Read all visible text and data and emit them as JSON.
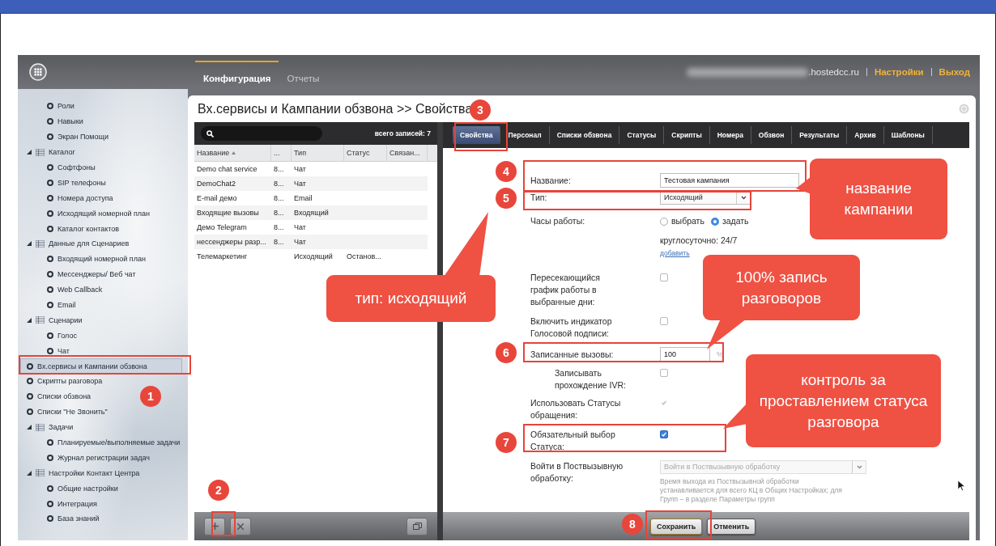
{
  "header": {
    "tabs": [
      {
        "label": "Конфигурация",
        "selected": true
      },
      {
        "label": "Отчеты",
        "selected": false
      }
    ],
    "domain": ".hostedcc.ru",
    "links": [
      "Настройки",
      "Выход"
    ]
  },
  "sidebar": {
    "items": [
      {
        "kind": "group",
        "children": [
          {
            "label": "Роли",
            "selected": false
          },
          {
            "label": "Навыки",
            "selected": false
          },
          {
            "label": "Экран Помощи",
            "selected": false
          }
        ]
      },
      {
        "kind": "group",
        "label": "Каталог",
        "expanded": true,
        "children": [
          {
            "label": "Софтфоны",
            "selected": false
          },
          {
            "label": "SIP телефоны",
            "selected": false
          },
          {
            "label": "Номера доступа",
            "selected": false
          },
          {
            "label": "Исходящий номерной план",
            "selected": false
          },
          {
            "label": "Каталог контактов",
            "selected": false
          }
        ]
      },
      {
        "kind": "group",
        "label": "Данные для Сценариев",
        "expanded": true,
        "children": [
          {
            "label": "Входящий номерной план",
            "selected": false
          },
          {
            "label": "Мессенджеры/ Веб чат",
            "selected": false
          },
          {
            "label": "Web Callback",
            "selected": false
          },
          {
            "label": "Email",
            "selected": false
          }
        ]
      },
      {
        "kind": "group",
        "label": "Сценарии",
        "expanded": true,
        "children": [
          {
            "label": "Голос",
            "selected": false
          },
          {
            "label": "Чат",
            "selected": false
          }
        ]
      },
      {
        "kind": "leaf",
        "label": "Вх.сервисы и Кампании обзвона",
        "selected": true
      },
      {
        "kind": "leaf",
        "label": "Скрипты разговора",
        "selected": false
      },
      {
        "kind": "leaf",
        "label": "Списки обзвона",
        "selected": false
      },
      {
        "kind": "leaf",
        "label": "Списки \"Не Звонить\"",
        "selected": false
      },
      {
        "kind": "group",
        "label": "Задачи",
        "expanded": true,
        "children": [
          {
            "label": "Планируемые/выполняемые задачи",
            "selected": false
          },
          {
            "label": "Журнал регистрации задач",
            "selected": false
          }
        ]
      },
      {
        "kind": "group",
        "label": "Настройки Контакт Центра",
        "expanded": true,
        "children": [
          {
            "label": "Общие настройки",
            "selected": false
          },
          {
            "label": "Интеграция",
            "selected": false
          },
          {
            "label": "База знаний",
            "selected": false
          }
        ]
      }
    ]
  },
  "page_title": "Вх.сервисы и Кампании обзвона >> Свойства",
  "records": {
    "total": "всего записей: 7",
    "columns": [
      {
        "label": "Название",
        "sorted": true
      },
      {
        "label": "...",
        "sorted": false
      },
      {
        "label": "Тип",
        "sorted": false
      },
      {
        "label": "Статус",
        "sorted": false
      },
      {
        "label": "Связан...",
        "sorted": false
      }
    ],
    "rows": [
      {
        "name": "Demo chat service",
        "column_2": "8...",
        "type": "Чат"
      },
      {
        "name": "DemoChat2",
        "column_2": "8...",
        "type": "Чат"
      },
      {
        "name": "E-mail демо",
        "column_2": "8...",
        "type": "Email"
      },
      {
        "name": "Входящие вызовы",
        "column_2": "8...",
        "type": "Входящий"
      },
      {
        "name": "Демо Telegram",
        "column_2": "8...",
        "type": "Чат"
      },
      {
        "name": "нессенджеры разр...",
        "column_2": "8...",
        "type": "Чат"
      },
      {
        "name": "Телемаркетинг",
        "type": "Исходящий",
        "status": "Останов..."
      }
    ]
  },
  "properties": {
    "tabs": [
      {
        "label": "Свойства",
        "selected": true
      },
      {
        "label": "Персонал",
        "selected": false
      },
      {
        "label": "Списки обзвона",
        "selected": false
      },
      {
        "label": "Статусы",
        "selected": false
      },
      {
        "label": "Скрипты",
        "selected": false
      },
      {
        "label": "Номера",
        "selected": false
      },
      {
        "label": "Обзвон",
        "selected": false
      },
      {
        "label": "Результаты",
        "selected": false
      },
      {
        "label": "Архив",
        "selected": false
      },
      {
        "label": "Шаблоны",
        "selected": false
      }
    ],
    "fields": [
      {
        "kind": "text",
        "label": "Название:",
        "value": "Тестовая кампания"
      },
      {
        "kind": "select",
        "label": "Тип:",
        "value": "Исходящий"
      },
      {
        "kind": "radio",
        "label": "Часы работы:",
        "options": [
          {
            "label": "выбрать",
            "selected": false
          },
          {
            "label": "задать",
            "selected": true
          }
        ],
        "note": "круглосуточно: 24/7",
        "link": "добавить"
      },
      {
        "kind": "checkbox",
        "label": "Пересекающийся график работы в выбранные дни:",
        "checked": false,
        "disabled": false
      },
      {
        "kind": "checkbox",
        "label": "Включить индикатор Голосовой подписи:",
        "checked": false,
        "disabled": false
      },
      {
        "kind": "percent",
        "label": "Записанные вызовы:",
        "value": "100",
        "unit": "%"
      },
      {
        "kind": "sub_checkbox",
        "label": "Записывать прохождение IVR:",
        "checked": false,
        "disabled": false
      },
      {
        "kind": "checkbox",
        "label": "Использовать Статусы обращения:",
        "checked": true,
        "disabled": true
      },
      {
        "kind": "checkbox",
        "label": "Обязательный выбор Статуса:",
        "checked": true,
        "disabled": false
      },
      {
        "kind": "post",
        "label": "Войти в Поствызывную обработку:",
        "placeholder": "Войти в Поствызывную обработку",
        "disabled": true,
        "hint": "Время выхода из Поствызывной обработки устанавливается для всего КЦ в Общих Настройках; для Групп – в разделе Параметры групп"
      }
    ],
    "buttons": [
      "Сохранить",
      "Отменить"
    ]
  },
  "annotations": {
    "markers": [
      "1",
      "2",
      "3",
      "4",
      "5",
      "6",
      "7",
      "8"
    ],
    "callouts": [
      "название кампании",
      "тип: исходящий",
      "100% запись разговоров",
      "контроль за проставлением статуса разговора"
    ]
  }
}
